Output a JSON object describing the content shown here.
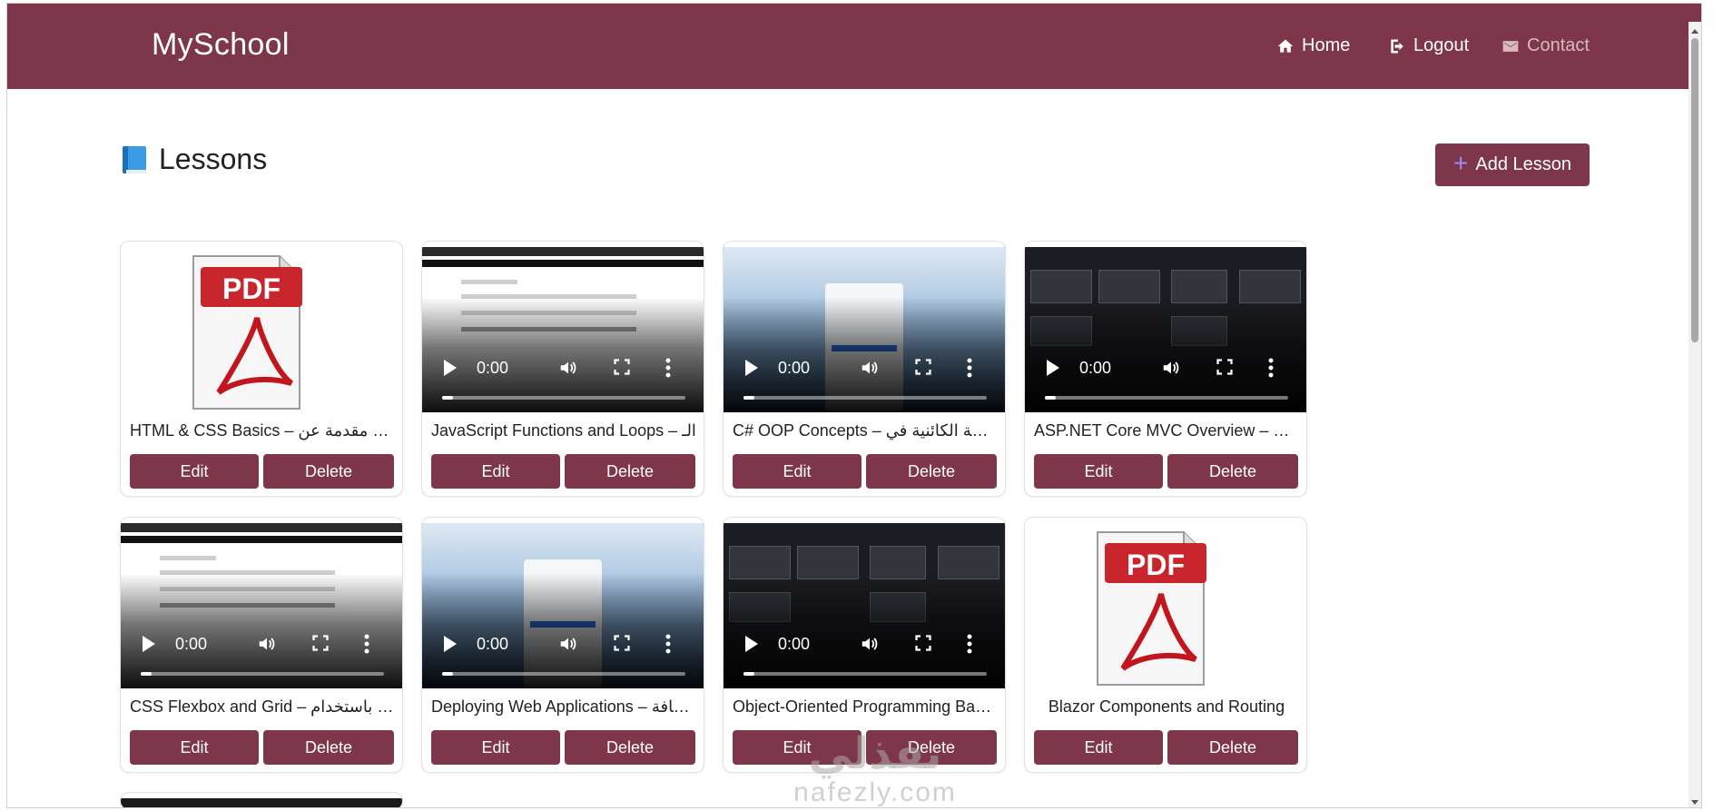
{
  "navbar": {
    "brand": "MySchool",
    "links": [
      {
        "label": "Home",
        "icon": "home-icon"
      },
      {
        "label": "Logout",
        "icon": "logout-icon"
      },
      {
        "label": "Contact",
        "icon": "envelope-icon"
      }
    ],
    "color": "#7e364b"
  },
  "page": {
    "title": "Lessons",
    "add_button": "Add Lesson"
  },
  "video_time": "0:00",
  "lessons": [
    {
      "title": "HTML & CSS Basics – مقدمة عن HTML",
      "media": "pdf"
    },
    {
      "title": "JavaScript Functions and Loops – الـ",
      "media": "video"
    },
    {
      "title": "C# OOP Concepts – البرمجة الكائنية في",
      "media": "video"
    },
    {
      "title": "ASP.NET Core MVC Overview – مشروع",
      "media": "video"
    },
    {
      "title": "CSS Flexbox and Grid – صفحة باستخدام",
      "media": "video"
    },
    {
      "title": "Deploying Web Applications – استضافة",
      "media": "video"
    },
    {
      "title": "Object-Oriented Programming Basics",
      "media": "video"
    },
    {
      "title": "Blazor Components and Routing",
      "media": "pdf"
    }
  ],
  "actions": {
    "edit": "Edit",
    "delete": "Delete"
  },
  "pdf_label": "PDF",
  "watermark": {
    "arabic": "نفذلي",
    "latin": "nafezly.com"
  }
}
